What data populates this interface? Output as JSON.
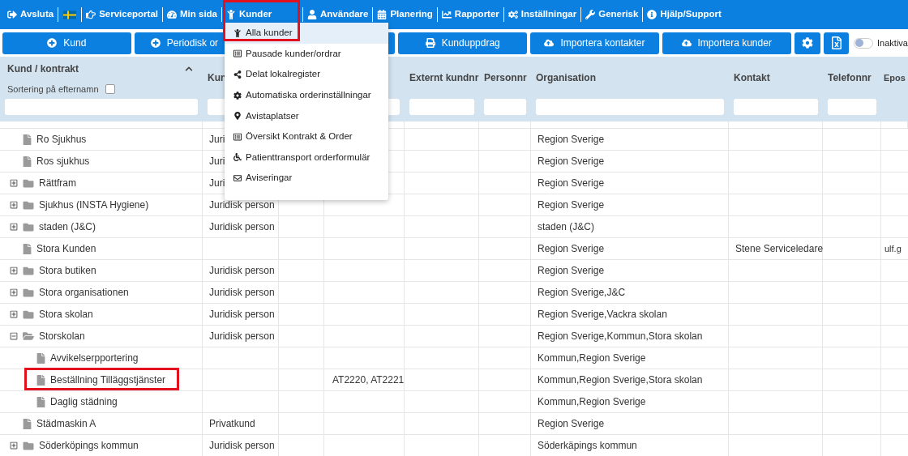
{
  "nav": [
    {
      "kind": "logout",
      "label": "Avsluta",
      "highlighted": false
    },
    {
      "kind": "flag",
      "highlighted": false
    },
    {
      "kind": "hand",
      "label": "Serviceportal",
      "highlighted": false
    },
    {
      "kind": "gauge",
      "label": "Min sida",
      "highlighted": false
    },
    {
      "kind": "child",
      "label": "Kunder",
      "highlighted": true
    },
    {
      "kind": "user",
      "label": "Användare",
      "highlighted": false
    },
    {
      "kind": "calendar",
      "label": "Planering",
      "highlighted": false
    },
    {
      "kind": "chart",
      "label": "Rapporter",
      "highlighted": false
    },
    {
      "kind": "cogs",
      "label": "Inställningar",
      "highlighted": false
    },
    {
      "kind": "wrench",
      "label": "Generisk",
      "highlighted": false
    },
    {
      "kind": "info",
      "label": "Hjälp/Support",
      "highlighted": false
    }
  ],
  "menu": [
    {
      "kind": "child",
      "label": "Alla kunder",
      "selected": true
    },
    {
      "kind": "list",
      "label": "Pausade kunder/ordrar",
      "selected": false
    },
    {
      "kind": "share",
      "label": "Delat lokalregister",
      "selected": false
    },
    {
      "kind": "cog",
      "label": "Automatiska orderinställningar",
      "selected": false
    },
    {
      "kind": "pin",
      "label": "Avistaplatser",
      "selected": false
    },
    {
      "kind": "list",
      "label": "Översikt Kontrakt & Order",
      "selected": false
    },
    {
      "kind": "wheelchair",
      "label": "Patienttransport orderformulär",
      "selected": false
    },
    {
      "kind": "envelope",
      "label": "Aviseringar",
      "selected": false
    }
  ],
  "toolbar": [
    {
      "kind": "plus",
      "label": "Kund"
    },
    {
      "kind": "plus",
      "label": "Periodisk or"
    },
    {
      "kind": "blank"
    },
    {
      "kind": "print",
      "label": "Kunduppdrag"
    },
    {
      "kind": "upload",
      "label": "Importera kontakter"
    },
    {
      "kind": "upload",
      "label": "Importera kunder"
    },
    {
      "kind": "gear"
    },
    {
      "kind": "excel"
    }
  ],
  "inactive_toggle": {
    "label": "Inaktiva",
    "on": false
  },
  "table": {
    "sort_label": "Sortering på efternamn",
    "sort_checked": false,
    "columns": [
      "Kund / kontrakt",
      "Kun",
      null,
      null,
      "Externt kundnr",
      "Personnr",
      "Organisation",
      "Kontakt",
      "Telefonnr",
      "Epos"
    ],
    "rows": [
      {
        "kind": "file",
        "name": "Ro Sjukhus",
        "type": "Juri",
        "organisation": "Region Sverige"
      },
      {
        "kind": "file",
        "name": "Ros sjukhus",
        "type": "Juri",
        "organisation": "Region Sverige"
      },
      {
        "kind": "folder",
        "expanded": false,
        "name": "Rättfram",
        "type": "Juri",
        "organisation": "Region Sverige"
      },
      {
        "kind": "folder",
        "expanded": false,
        "name": "Sjukhus (INSTA Hygiene)",
        "type": "Juridisk person",
        "organisation": "Region Sverige"
      },
      {
        "kind": "folder",
        "expanded": false,
        "name": "staden (J&C)",
        "type": "Juridisk person",
        "organisation": "staden (J&C)"
      },
      {
        "kind": "file",
        "name": "Stora Kunden",
        "organisation": "Region Sverige",
        "contact": "Stene Serviceledare",
        "email": "ulf.g"
      },
      {
        "kind": "folder",
        "expanded": false,
        "name": "Stora butiken",
        "type": "Juridisk person",
        "organisation": "Region Sverige"
      },
      {
        "kind": "folder",
        "expanded": false,
        "name": "Stora organisationen",
        "type": "Juridisk person",
        "organisation": "Region Sverige,J&C"
      },
      {
        "kind": "folder",
        "expanded": false,
        "name": "Stora skolan",
        "type": "Juridisk person",
        "organisation": "Region Sverige,Vackra skolan"
      },
      {
        "kind": "folder",
        "expanded": true,
        "name": "Storskolan",
        "type": "Juridisk person",
        "organisation": "Region Sverige,Kommun,Stora skolan",
        "children": [
          {
            "kind": "file",
            "name": "Avvikelserpportering",
            "organisation": "Kommun,Region Sverige",
            "highlighted": false
          },
          {
            "kind": "file",
            "name": "Beställning Tilläggstjänster",
            "column_3": "AT2220, AT2221",
            "organisation": "Kommun,Region Sverige,Stora skolan",
            "highlighted": true
          },
          {
            "kind": "file",
            "name": "Daglig städning",
            "organisation": "Kommun,Region Sverige",
            "highlighted": false
          }
        ]
      },
      {
        "kind": "file",
        "name": "Städmaskin A",
        "type": "Privatkund",
        "organisation": "Region Sverige"
      },
      {
        "kind": "folder",
        "expanded": false,
        "name": "Söderköpings kommun",
        "type": "Juridisk person",
        "organisation": "Söderkäpings kommun"
      }
    ]
  }
}
